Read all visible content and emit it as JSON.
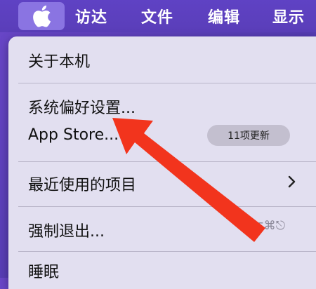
{
  "menubar": {
    "apple_icon": "apple-logo-icon",
    "titles": [
      "访达",
      "文件",
      "编辑",
      "显示"
    ]
  },
  "menu": {
    "about": "关于本机",
    "system_prefs": "系统偏好设置...",
    "app_store": "App Store...",
    "app_store_badge": "11项更新",
    "recent_items": "最近使用的项目",
    "force_quit": "强制退出...",
    "force_quit_shortcut": "⌥⌘⎋",
    "sleep": "睡眠"
  },
  "annotation": {
    "arrow_color": "#f2341d"
  }
}
